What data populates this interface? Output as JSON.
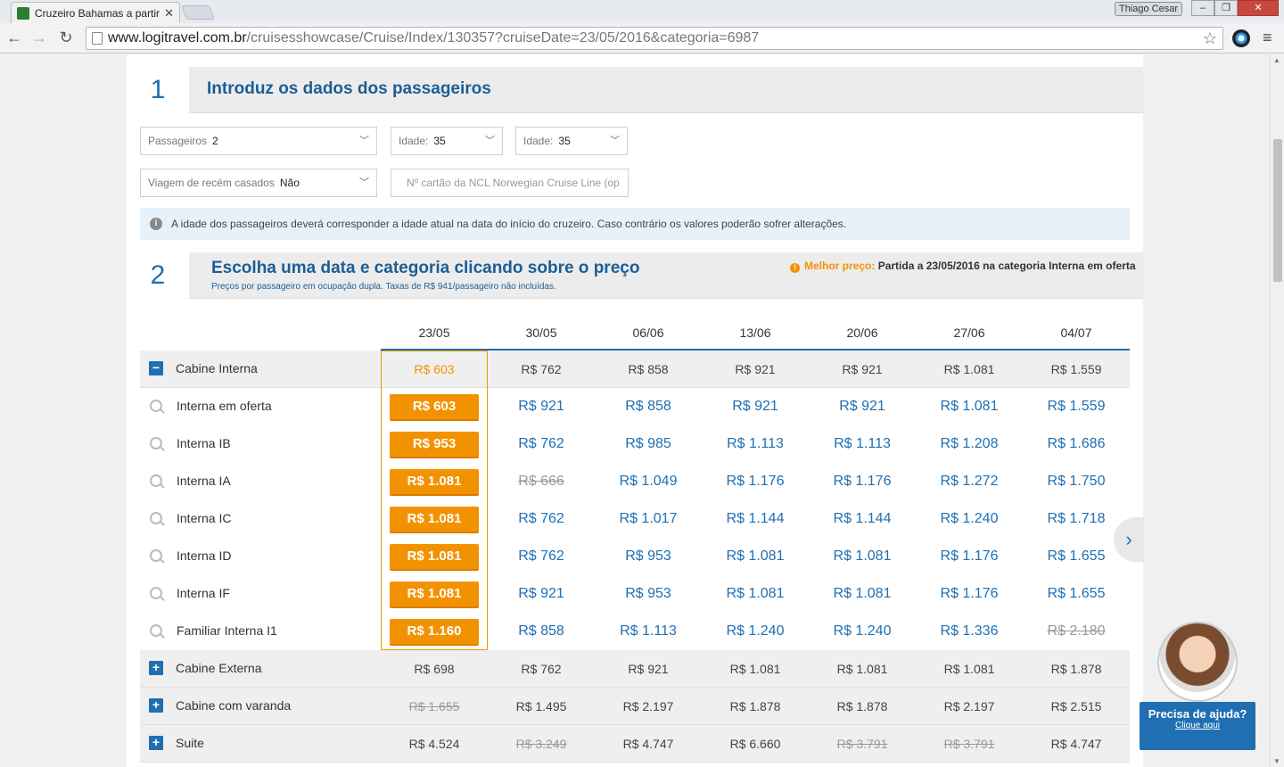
{
  "browser": {
    "tab_title": "Cruzeiro Bahamas a partir",
    "user": "Thiago Cesar",
    "url_host": "www.logitravel.com.br",
    "url_path": "/cruisesshowcase/Cruise/Index/130357?cruiseDate=23/05/2016&categoria=6987"
  },
  "step1": {
    "number": "1",
    "title": "Introduz os dados dos passageiros",
    "passengers_label": "Passageiros",
    "passengers_value": "2",
    "age1_label": "Idade:",
    "age1_value": "35",
    "age2_label": "Idade:",
    "age2_value": "35",
    "newlywed_label": "Viagem de recém casados",
    "newlywed_value": "Não",
    "card_placeholder": "Nº cartão da NCL Norwegian Cruise Line (op",
    "info": "A idade dos passageiros deverá corresponder a idade atual na data do início do cruzeiro. Caso contrário os valores poderão sofrer alterações."
  },
  "step2": {
    "number": "2",
    "title": "Escolha uma data e categoria clicando sobre o preço",
    "subtitle": "Preços por passageiro em ocupação dupla. Taxas de R$ 941/passageiro não incluídas.",
    "best_label": "Melhor preço:",
    "best_text": "Partida a 23/05/2016 na categoria Interna em oferta"
  },
  "dates": [
    "23/05",
    "30/05",
    "06/06",
    "13/06",
    "20/06",
    "27/06",
    "04/07"
  ],
  "rows": [
    {
      "kind": "cat",
      "icon": "minus",
      "label": "Cabine Interna",
      "prices": [
        "R$ 603",
        "R$ 762",
        "R$ 858",
        "R$ 921",
        "R$ 921",
        "R$ 1.081",
        "R$ 1.559"
      ],
      "strike": []
    },
    {
      "kind": "sub",
      "label": "Interna em oferta",
      "prices": [
        "R$ 603",
        "R$ 921",
        "R$ 858",
        "R$ 921",
        "R$ 921",
        "R$ 1.081",
        "R$ 1.559"
      ],
      "strike": []
    },
    {
      "kind": "sub",
      "label": "Interna IB",
      "prices": [
        "R$ 953",
        "R$ 762",
        "R$ 985",
        "R$ 1.113",
        "R$ 1.113",
        "R$ 1.208",
        "R$ 1.686"
      ],
      "strike": []
    },
    {
      "kind": "sub",
      "label": "Interna IA",
      "prices": [
        "R$ 1.081",
        "R$ 666",
        "R$ 1.049",
        "R$ 1.176",
        "R$ 1.176",
        "R$ 1.272",
        "R$ 1.750"
      ],
      "strike": [
        1
      ]
    },
    {
      "kind": "sub",
      "label": "Interna IC",
      "prices": [
        "R$ 1.081",
        "R$ 762",
        "R$ 1.017",
        "R$ 1.144",
        "R$ 1.144",
        "R$ 1.240",
        "R$ 1.718"
      ],
      "strike": []
    },
    {
      "kind": "sub",
      "label": "Interna ID",
      "prices": [
        "R$ 1.081",
        "R$ 762",
        "R$ 953",
        "R$ 1.081",
        "R$ 1.081",
        "R$ 1.176",
        "R$ 1.655"
      ],
      "strike": []
    },
    {
      "kind": "sub",
      "label": "Interna IF",
      "prices": [
        "R$ 1.081",
        "R$ 921",
        "R$ 953",
        "R$ 1.081",
        "R$ 1.081",
        "R$ 1.176",
        "R$ 1.655"
      ],
      "strike": []
    },
    {
      "kind": "sub",
      "label": "Familiar Interna I1",
      "prices": [
        "R$ 1.160",
        "R$ 858",
        "R$ 1.113",
        "R$ 1.240",
        "R$ 1.240",
        "R$ 1.336",
        "R$ 2.180"
      ],
      "strike": [
        6
      ]
    },
    {
      "kind": "cat",
      "icon": "plus",
      "label": "Cabine Externa",
      "prices": [
        "R$ 698",
        "R$ 762",
        "R$ 921",
        "R$ 1.081",
        "R$ 1.081",
        "R$ 1.081",
        "R$ 1.878"
      ],
      "strike": []
    },
    {
      "kind": "cat",
      "icon": "plus",
      "label": "Cabine com varanda",
      "prices": [
        "R$ 1.655",
        "R$ 1.495",
        "R$ 2.197",
        "R$ 1.878",
        "R$ 1.878",
        "R$ 2.197",
        "R$ 2.515"
      ],
      "strike": [
        0
      ]
    },
    {
      "kind": "cat",
      "icon": "plus",
      "label": "Suite",
      "prices": [
        "R$ 4.524",
        "R$ 3.249",
        "R$ 4.747",
        "R$ 6.660",
        "R$ 3.791",
        "R$ 3.791",
        "R$ 4.747"
      ],
      "strike": [
        1,
        4,
        5
      ]
    }
  ],
  "help": {
    "title": "Precisa de ajuda?",
    "link": "Clique aqui"
  }
}
